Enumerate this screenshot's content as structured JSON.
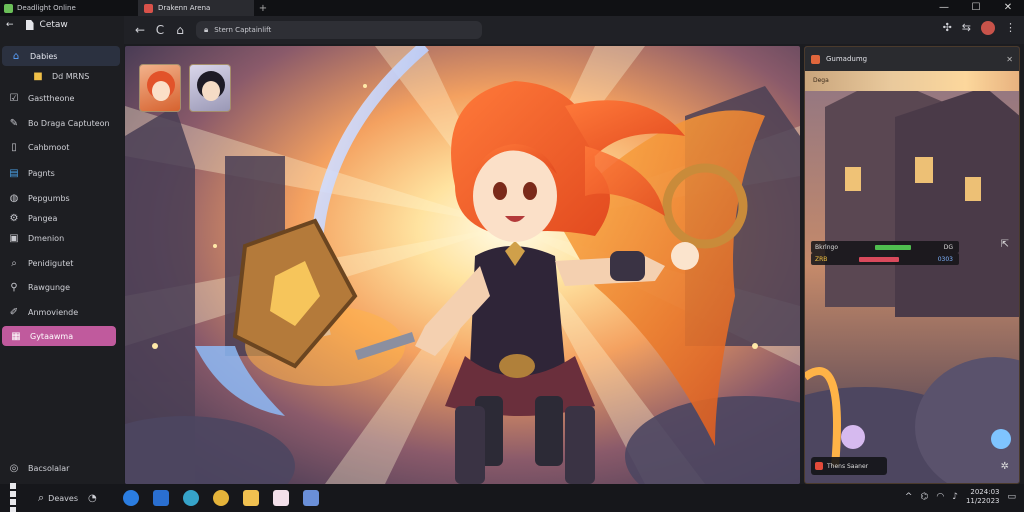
{
  "window": {
    "app_title": "Deadlight Online",
    "tab_label": "Drakenn Arena",
    "tab_add": "+",
    "controls": [
      "—",
      "☐",
      "✕"
    ]
  },
  "browser": {
    "address": "Stern Captainlift",
    "back": "←",
    "reload": "C",
    "home": "⌂"
  },
  "sidebar": {
    "header": "Cetaw",
    "items": [
      {
        "label": "Dabies",
        "icon": "home-icon"
      },
      {
        "label": "Dd  MRNS",
        "icon": "folder-icon"
      },
      {
        "label": "Gasttheone",
        "icon": "checkbox-icon"
      },
      {
        "label": "Bo Draga Captuteon",
        "icon": "brush-icon"
      },
      {
        "label": "Cahbmoot",
        "icon": "book-icon"
      },
      {
        "label": "Pagnts",
        "icon": "page-icon"
      },
      {
        "label": "Pepgumbs",
        "icon": "globe-icon"
      },
      {
        "label": "Pangea",
        "icon": "settings-icon"
      },
      {
        "label": "Dmenion",
        "icon": "square-icon"
      },
      {
        "label": "Penidigutet",
        "icon": "search-icon"
      },
      {
        "label": "Rawgunge",
        "icon": "pin-icon"
      },
      {
        "label": "Anmoviende",
        "icon": "pen-icon"
      },
      {
        "label": "Gytaawma",
        "icon": "calendar-icon"
      }
    ],
    "footer": "Bacsolalar"
  },
  "panel": {
    "title": "Gumadumg",
    "close": "✕",
    "strip": "Dega",
    "stats": [
      {
        "left": "Bkrlngo",
        "right": "DG"
      },
      {
        "left": "ZRB",
        "right": "0303"
      }
    ],
    "hp_fraction": 0.45,
    "chip": "Thens  Saaner"
  },
  "taskbar": {
    "search": "Deaves",
    "clock_time": "2024:03",
    "clock_date": "11/22023"
  },
  "colors": {
    "accent": "#c05a9d",
    "home_highlight": "#5aa2ff"
  }
}
